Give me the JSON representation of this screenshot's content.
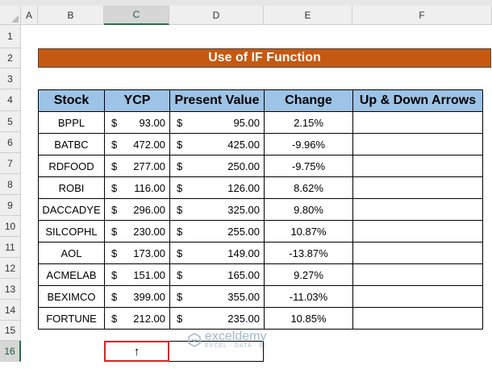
{
  "columns": [
    "A",
    "B",
    "C",
    "D",
    "E",
    "F"
  ],
  "rows": [
    "1",
    "2",
    "3",
    "4",
    "5",
    "6",
    "7",
    "8",
    "9",
    "10",
    "11",
    "12",
    "13",
    "14",
    "15",
    "16"
  ],
  "title": "Use of IF Function",
  "headers": [
    "Stock",
    "YCP",
    "Present Value",
    "Change",
    "Up & Down Arrows"
  ],
  "currency_symbol": "$",
  "table": [
    {
      "stock": "BPPL",
      "ycp": "93.00",
      "pv": "95.00",
      "change": "2.15%"
    },
    {
      "stock": "BATBC",
      "ycp": "472.00",
      "pv": "425.00",
      "change": "-9.96%"
    },
    {
      "stock": "RDFOOD",
      "ycp": "277.00",
      "pv": "250.00",
      "change": "-9.75%"
    },
    {
      "stock": "ROBI",
      "ycp": "116.00",
      "pv": "126.00",
      "change": "8.62%"
    },
    {
      "stock": "DACCADYE",
      "ycp": "296.00",
      "pv": "325.00",
      "change": "9.80%"
    },
    {
      "stock": "SILCOPHL",
      "ycp": "230.00",
      "pv": "255.00",
      "change": "10.87%"
    },
    {
      "stock": "AOL",
      "ycp": "173.00",
      "pv": "149.00",
      "change": "-13.87%"
    },
    {
      "stock": "ACMELAB",
      "ycp": "151.00",
      "pv": "165.00",
      "change": "9.27%"
    },
    {
      "stock": "BEXIMCO",
      "ycp": "399.00",
      "pv": "355.00",
      "change": "-11.03%"
    },
    {
      "stock": "FORTUNE",
      "ycp": "212.00",
      "pv": "235.00",
      "change": "10.85%"
    }
  ],
  "selected_cell_value": "↑",
  "watermark": {
    "name": "exceldemy",
    "tag": "EXCEL · DATA · BI"
  },
  "colors": {
    "title_bg": "#c65911",
    "header_bg": "#9dc3e6",
    "selection": "#e02020"
  }
}
